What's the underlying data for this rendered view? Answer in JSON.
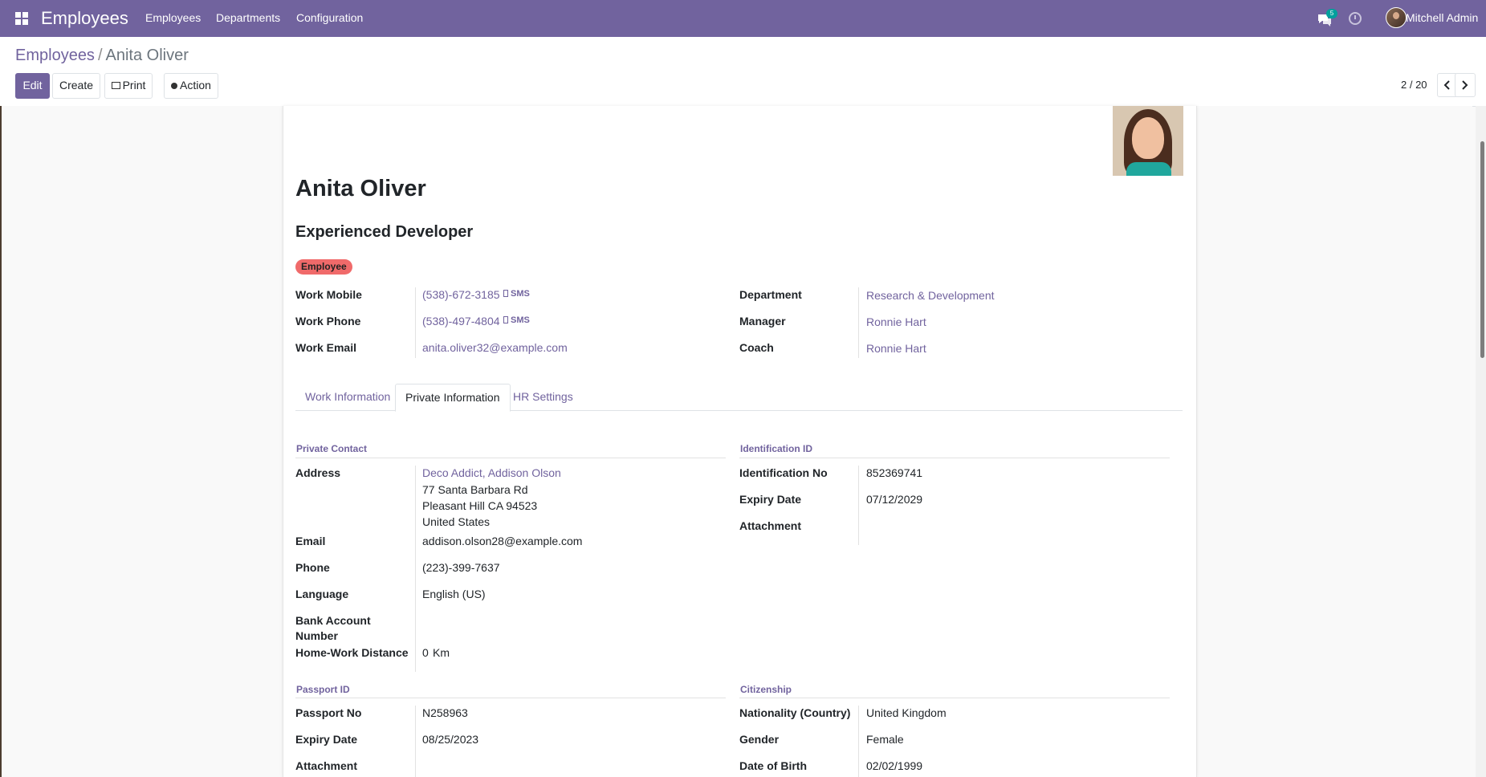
{
  "topbar": {
    "app_name": "Employees",
    "menu": [
      "Employees",
      "Departments",
      "Configuration"
    ],
    "messages_count": "5",
    "user_name": "Mitchell Admin"
  },
  "breadcrumb": {
    "parent": "Employees",
    "separator": "/",
    "current": "Anita Oliver"
  },
  "toolbar": {
    "edit": "Edit",
    "create": "Create",
    "print": "Print",
    "action": "Action"
  },
  "pager": {
    "value": "2 / 20"
  },
  "employee": {
    "name": "Anita Oliver",
    "job_title": "Experienced Developer",
    "tag": "Employee",
    "work_mobile_label": "Work Mobile",
    "work_mobile": "(538)-672-3185",
    "work_phone_label": "Work Phone",
    "work_phone": "(538)-497-4804",
    "work_email_label": "Work Email",
    "work_email": "anita.oliver32@example.com",
    "sms_label": "SMS",
    "department_label": "Department",
    "department": "Research & Development",
    "manager_label": "Manager",
    "manager": "Ronnie Hart",
    "coach_label": "Coach",
    "coach": "Ronnie Hart"
  },
  "tabs": [
    "Work Information",
    "Private Information",
    "HR Settings"
  ],
  "private_contact": {
    "title": "Private Contact",
    "address_label": "Address",
    "address_name": "Deco Addict, Addison Olson",
    "address_line1": "77 Santa Barbara Rd",
    "address_line2": "Pleasant Hill CA 94523",
    "address_line3": "United States",
    "email_label": "Email",
    "email": "addison.olson28@example.com",
    "phone_label": "Phone",
    "phone": "(223)-399-7637",
    "language_label": "Language",
    "language": "English (US)",
    "bank_label_1": "Bank Account",
    "bank_label_2": "Number",
    "distance_label": "Home-Work Distance",
    "distance": "0",
    "distance_unit": "Km"
  },
  "identification": {
    "title": "Identification ID",
    "number_label": "Identification No",
    "number": "852369741",
    "expiry_label": "Expiry Date",
    "expiry": "07/12/2029",
    "attachment_label": "Attachment"
  },
  "passport": {
    "title": "Passport ID",
    "number_label": "Passport No",
    "number": "N258963",
    "expiry_label": "Expiry Date",
    "expiry": "08/25/2023",
    "attachment_label": "Attachment"
  },
  "citizenship": {
    "title": "Citizenship",
    "nationality_label": "Nationality (Country)",
    "nationality": "United Kingdom",
    "gender_label": "Gender",
    "gender": "Female",
    "birth_label": "Date of Birth",
    "birth": "02/02/1999"
  },
  "colors": {
    "brand": "#71639e",
    "tag": "#f06a6a"
  }
}
